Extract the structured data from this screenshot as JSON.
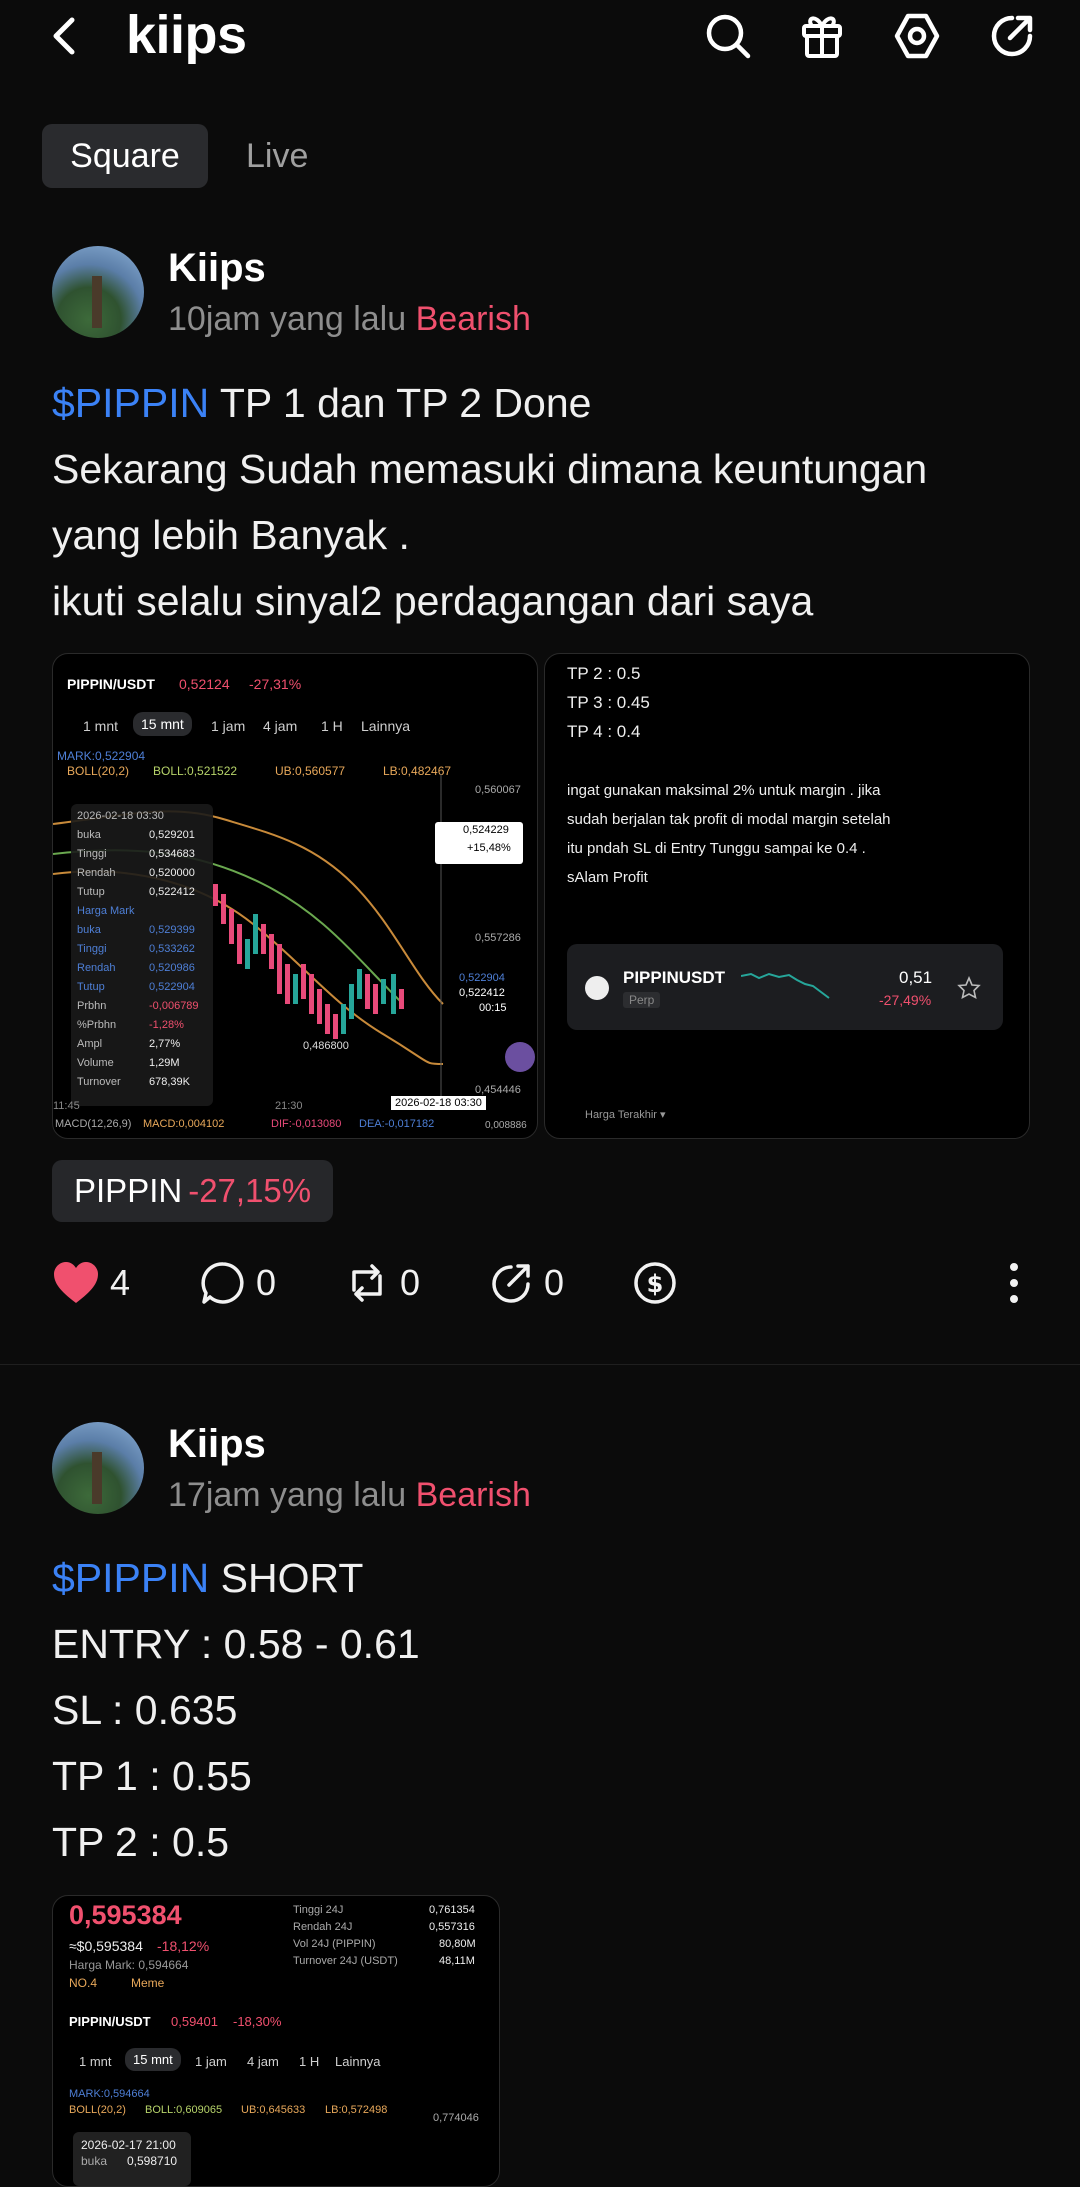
{
  "header": {
    "title": "kiips",
    "icons": [
      "back-icon",
      "search-icon",
      "gift-icon",
      "settings-icon",
      "share-icon"
    ]
  },
  "tabs": [
    {
      "label": "Square",
      "active": true
    },
    {
      "label": "Live",
      "active": false
    }
  ],
  "posts": [
    {
      "author": "Kiips",
      "time": "10jam yang lalu",
      "sentiment": "Bearish",
      "ticker": "$PIPPIN",
      "line1_rest": " TP 1 dan TP 2 Done",
      "lines": [
        "Sekarang Sudah memasuki dimana keuntungan",
        "yang lebih Banyak .",
        "ikuti selalu sinyal2 perdagangan dari saya"
      ],
      "image_left": {
        "pair": "PIPPIN/USDT",
        "price": "0,52124",
        "change": "-27,31%",
        "intervals": [
          "1 mnt",
          "15 mnt",
          "1 jam",
          "4 jam",
          "1 H",
          "Lainnya"
        ],
        "active_interval": "15 mnt",
        "mark": "MARK:0,522904",
        "boll": "BOLL(20,2)",
        "boll_mid": "BOLL:0,521522",
        "boll_ub": "UB:0,560577",
        "boll_lb": "LB:0,482467",
        "tooltip": [
          [
            "2026-02-18 03:30",
            ""
          ],
          [
            "buka",
            "0,529201"
          ],
          [
            "Tinggi",
            "0,534683"
          ],
          [
            "Rendah",
            "0,520000"
          ],
          [
            "Tutup",
            "0,522412"
          ],
          [
            "Harga Mark",
            ""
          ],
          [
            "buka",
            "0,529399"
          ],
          [
            "Tinggi",
            "0,533262"
          ],
          [
            "Rendah",
            "0,520986"
          ],
          [
            "Tutup",
            "0,522904"
          ],
          [
            "Prbhn",
            "-0,006789"
          ],
          [
            "%Prbhn",
            "-1,28%"
          ],
          [
            "Ampl",
            "2,77%"
          ],
          [
            "Volume",
            "1,29M"
          ],
          [
            "Turnover",
            "678,39K"
          ]
        ],
        "axis": [
          "0,560067",
          "0,557286",
          "0,454446",
          "0,008886"
        ],
        "label_low": "0,486800",
        "tag_price": "0,524229",
        "tag_pct": "+15,48%",
        "tag2": "0,522904",
        "tag3": "0,522412",
        "tag4": "00:15",
        "time_label": "2026-02-18 03:30",
        "xt1": "11:45",
        "xt2": "21:30",
        "macd": "MACD(12,26,9)",
        "macd_v": "MACD:0,004102",
        "dif": "DIF:-0,013080",
        "dea": "DEA:-0,017182"
      },
      "image_right": {
        "tps": [
          "TP 2 : 0.5",
          "TP 3 : 0.45",
          "TP 4 : 0.4"
        ],
        "note": [
          "ingat gunakan maksimal 2% untuk margin . jika",
          "sudah berjalan tak profit di modal margin setelah",
          "itu pndah SL di Entry Tunggu sampai ke 0.4 .",
          "sAlam Profit"
        ],
        "card_pair": "PIPPINUSDT",
        "card_type": "Perp",
        "card_price": "0,51",
        "card_change": "-27,49%",
        "footer": "Harga Terakhir ▾"
      },
      "chip": {
        "name": "PIPPIN",
        "change": "-27,15%"
      },
      "actions": {
        "likes": "4",
        "comments": "0",
        "reposts": "0",
        "shares": "0"
      }
    },
    {
      "author": "Kiips",
      "time": "17jam yang lalu",
      "sentiment": "Bearish",
      "ticker": "$PIPPIN",
      "line1_rest": " SHORT",
      "lines": [
        "ENTRY : 0.58 - 0.61",
        "SL : 0.635",
        "TP 1 : 0.55",
        "TP 2 : 0.5"
      ],
      "image": {
        "price": "0,595384",
        "usd": "≈$0,595384",
        "change": "-18,12%",
        "mark_label": "Harga Mark: 0,594664",
        "rank": "NO.4",
        "tag": "Meme",
        "stats": [
          [
            "Tinggi 24J",
            "0,761354"
          ],
          [
            "Rendah 24J",
            "0,557316"
          ],
          [
            "Vol 24J (PIPPIN)",
            "80,80M"
          ],
          [
            "Turnover 24J (USDT)",
            "48,11M"
          ]
        ],
        "pair": "PIPPIN/USDT",
        "pair_price": "0,59401",
        "pair_change": "-18,30%",
        "intervals": [
          "1 mnt",
          "15 mnt",
          "1 jam",
          "4 jam",
          "1 H",
          "Lainnya"
        ],
        "active_interval": "15 mnt",
        "mark": "MARK:0,594664",
        "boll": "BOLL(20,2)",
        "boll_mid": "BOLL:0,609065",
        "boll_ub": "UB:0,645633",
        "boll_lb": "LB:0,572498",
        "axis": "0,774046",
        "tooltip_date": "2026-02-17 21:00",
        "tooltip_label": "buka",
        "tooltip_val": "0,598710"
      }
    }
  ],
  "colors": {
    "bearish": "#f0506e",
    "ticker": "#3b82f6",
    "like": "#f0506e"
  }
}
